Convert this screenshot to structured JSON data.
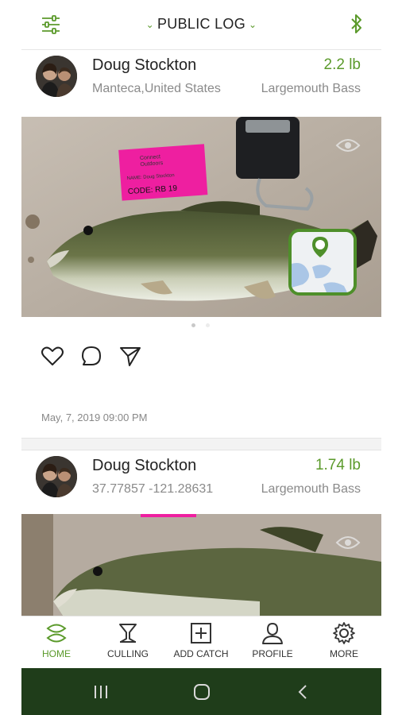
{
  "header": {
    "title": "PUBLIC LOG"
  },
  "posts": [
    {
      "user": "Doug Stockton",
      "location": "Manteca,United States",
      "weight": "2.2 lb",
      "species": "Largemouth Bass",
      "tag": {
        "line1": "Connect",
        "line2": "Outdoors",
        "name_line": "NAME: Doug Stockton",
        "code_line": "CODE: RB 19"
      },
      "date": "May, 7, 2019 09:00 PM"
    },
    {
      "user": "Doug Stockton",
      "location": "37.77857 -121.28631",
      "weight": "1.74 lb",
      "species": "Largemouth Bass"
    }
  ],
  "nav": {
    "items": [
      {
        "label": "HOME",
        "icon": "fish-icon",
        "active": true
      },
      {
        "label": "CULLING",
        "icon": "culling-icon"
      },
      {
        "label": "ADD CATCH",
        "icon": "add-icon"
      },
      {
        "label": "PROFILE",
        "icon": "profile-icon"
      },
      {
        "label": "MORE",
        "icon": "gear-icon"
      }
    ]
  },
  "colors": {
    "accent": "#5b9a2b",
    "system_bar": "#1f3d1a",
    "tag_pink": "#ee1fa0"
  }
}
